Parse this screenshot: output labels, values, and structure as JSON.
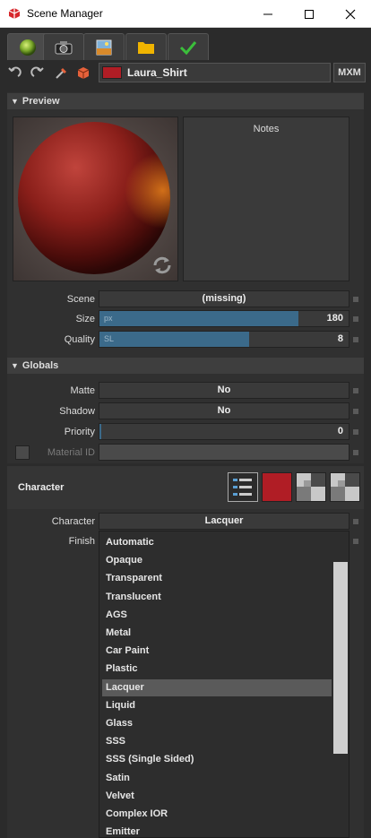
{
  "window": {
    "title": "Scene Manager"
  },
  "tabs": [
    {
      "icon": "material-sphere-icon",
      "active": true
    },
    {
      "icon": "camera-icon",
      "active": false
    },
    {
      "icon": "environment-image-icon",
      "active": false
    },
    {
      "icon": "folder-icon",
      "active": false
    },
    {
      "icon": "checkmark-icon",
      "active": false
    }
  ],
  "toolbar": {
    "material_name": "Laura_Shirt",
    "material_color": "#b01d25",
    "mxm_label": "MXM"
  },
  "preview": {
    "section_label": "Preview",
    "notes_label": "Notes",
    "rows": {
      "scene": {
        "label": "Scene",
        "value": "(missing)"
      },
      "size": {
        "label": "Size",
        "unit": "px",
        "value": "180",
        "fill_fraction": 0.8
      },
      "quality": {
        "label": "Quality",
        "unit": "SL",
        "value": "8",
        "fill_fraction": 0.6
      }
    }
  },
  "globals": {
    "section_label": "Globals",
    "rows": {
      "matte": {
        "label": "Matte",
        "value": "No"
      },
      "shadow": {
        "label": "Shadow",
        "value": "No"
      },
      "priority": {
        "label": "Priority",
        "value": "0"
      },
      "material_id": {
        "label": "Material ID"
      }
    }
  },
  "character": {
    "section_label": "Character",
    "accent_color": "#b01d25",
    "character_row": {
      "label": "Character",
      "value": "Lacquer"
    },
    "finish_row": {
      "label": "Finish"
    },
    "options": [
      "Automatic",
      "Opaque",
      "Transparent",
      "Translucent",
      "AGS",
      "Metal",
      "Car Paint",
      "Plastic",
      "Lacquer",
      "Liquid",
      "Glass",
      "SSS",
      "SSS (Single Sided)",
      "Satin",
      "Velvet",
      "Complex IOR",
      "Emitter"
    ],
    "selected_index": 8
  }
}
